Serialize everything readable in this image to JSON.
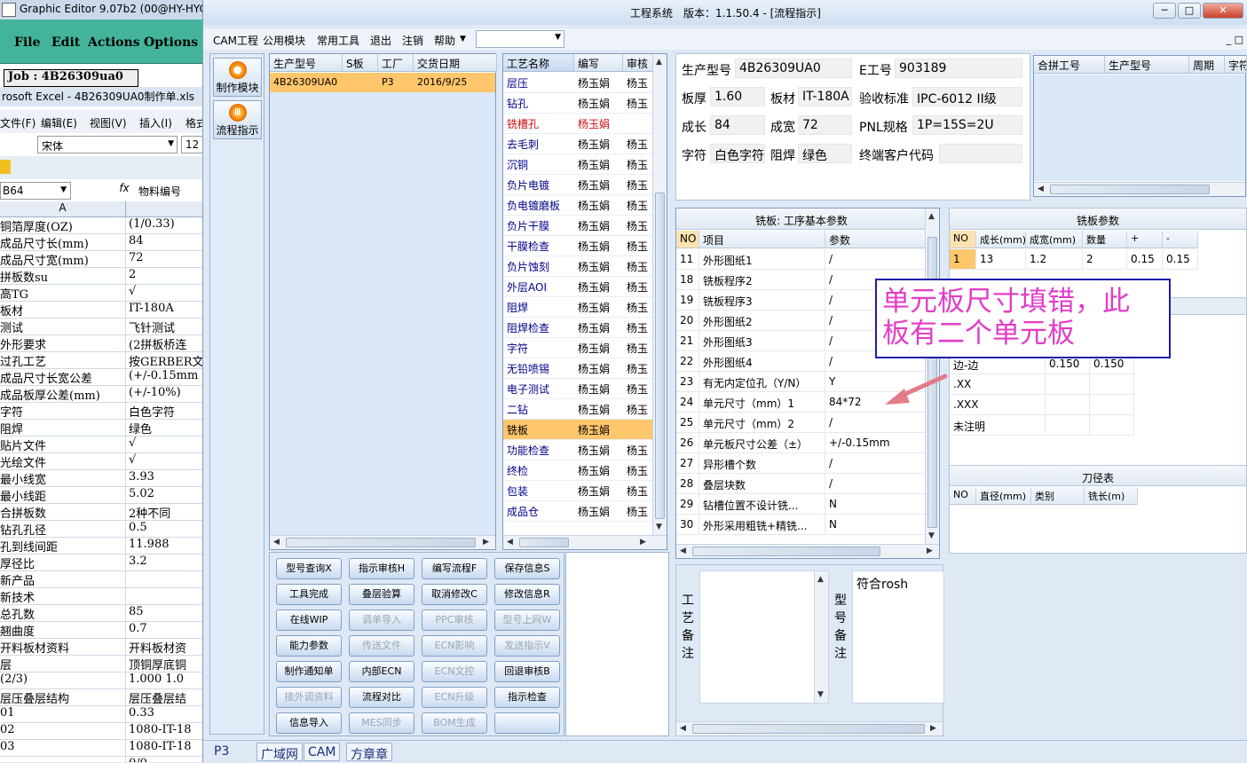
{
  "graphic_editor": {
    "title": "Graphic Editor 9.07b2 (00@HY-HYC",
    "menu": [
      "File",
      "Edit",
      "Actions",
      "Options"
    ],
    "job": "Job : 4B26309ua0"
  },
  "excel": {
    "title": "rosoft Excel - 4B26309UA0制作单.xls",
    "menu": [
      "文件(F)",
      "编辑(E)",
      "视图(V)",
      "插入(I)",
      "格式"
    ],
    "font_name": "宋体",
    "font_size": "12",
    "name_box": "B64",
    "fx": "fx",
    "formula": "物料编号",
    "col_header": "A",
    "rows": [
      [
        "铜箔厚度(OZ)",
        "(1/0.33)"
      ],
      [
        "成品尺寸长(mm)",
        "84"
      ],
      [
        "成品尺寸宽(mm)",
        "72"
      ],
      [
        "拼板数su",
        "2"
      ],
      [
        "高TG",
        "√"
      ],
      [
        "板材",
        "IT-180A"
      ],
      [
        "测试",
        "飞针测试"
      ],
      [
        "外形要求",
        "(2拼板桥连"
      ],
      [
        "过孔工艺",
        "按GERBER文"
      ],
      [
        "成品尺寸长宽公差",
        "(+/-0.15mm"
      ],
      [
        "成品板厚公差(mm)",
        "(+/-10%)"
      ],
      [
        "字符",
        "白色字符"
      ],
      [
        "阻焊",
        "绿色"
      ],
      [
        "贴片文件",
        "√"
      ],
      [
        "光绘文件",
        "√"
      ],
      [
        "最小线宽",
        "3.93"
      ],
      [
        "最小线距",
        "5.02"
      ],
      [
        "合拼板数",
        "2种不同"
      ],
      [
        "钻孔孔径",
        "0.5"
      ],
      [
        "孔到线间距",
        "11.988"
      ],
      [
        "厚径比",
        "3.2"
      ],
      [
        "新产品",
        ""
      ],
      [
        "新技术",
        ""
      ],
      [
        "总孔数",
        "85"
      ],
      [
        "翘曲度",
        "0.7"
      ],
      [
        "开料板材资料",
        "开料板材资"
      ],
      [
        "层",
        "顶铜厚底铜"
      ],
      [
        "(2/3)",
        "1.000  1.0"
      ],
      [
        "层压叠层结构",
        "层压叠层结"
      ],
      [
        "01",
        "0.33"
      ],
      [
        "02",
        "1080-IT-18"
      ],
      [
        "03",
        "1080-IT-18"
      ],
      [
        "",
        "0/0"
      ]
    ]
  },
  "cam": {
    "title": "工程系统　版本：1.1.50.4 - [流程指示]",
    "win_buttons": [
      "─",
      "□",
      "✕"
    ],
    "menu": [
      "CAM工程",
      "公用模块",
      "常用工具",
      "退出",
      "注销",
      "帮助"
    ],
    "mdi_buttons": "_ □",
    "nav": [
      {
        "label": "制作模块",
        "icon": "fire-icon"
      },
      {
        "label": "流程指示",
        "icon": "flow-icon"
      }
    ],
    "product_grid": {
      "headers": [
        "生产型号",
        "S板",
        "工厂",
        "交货日期"
      ],
      "rows": [
        [
          "4B26309UA0",
          "",
          "P3",
          "2016/9/25"
        ]
      ]
    },
    "process_grid": {
      "headers": [
        "工艺名称",
        "编写",
        "审核"
      ],
      "rows": [
        [
          "层压",
          "杨玉娟",
          "杨玉"
        ],
        [
          "钻孔",
          "杨玉娟",
          "杨玉"
        ],
        [
          "铣槽孔",
          "杨玉娟",
          ""
        ],
        [
          "去毛刺",
          "杨玉娟",
          "杨玉"
        ],
        [
          "沉铜",
          "杨玉娟",
          "杨玉"
        ],
        [
          "负片电镀",
          "杨玉娟",
          "杨玉"
        ],
        [
          "负电镀磨板",
          "杨玉娟",
          "杨玉"
        ],
        [
          "负片干膜",
          "杨玉娟",
          "杨玉"
        ],
        [
          "干膜检查",
          "杨玉娟",
          "杨玉"
        ],
        [
          "负片蚀刻",
          "杨玉娟",
          "杨玉"
        ],
        [
          "外层AOI",
          "杨玉娟",
          "杨玉"
        ],
        [
          "阻焊",
          "杨玉娟",
          "杨玉"
        ],
        [
          "阻焊检查",
          "杨玉娟",
          "杨玉"
        ],
        [
          "字符",
          "杨玉娟",
          "杨玉"
        ],
        [
          "无铅喷锡",
          "杨玉娟",
          "杨玉"
        ],
        [
          "电子测试",
          "杨玉娟",
          "杨玉"
        ],
        [
          "二钻",
          "杨玉娟",
          "杨玉"
        ],
        [
          "铣板",
          "杨玉娟",
          ""
        ],
        [
          "功能检查",
          "杨玉娟",
          "杨玉"
        ],
        [
          "终检",
          "杨玉娟",
          "杨玉"
        ],
        [
          "包装",
          "杨玉娟",
          "杨玉"
        ],
        [
          "成品仓",
          "杨玉娟",
          "杨玉"
        ]
      ]
    },
    "buttons": [
      [
        "型号查询X",
        "指示审核H",
        "编写流程F",
        "保存信息S"
      ],
      [
        "工具完成",
        "叠层验算",
        "取消修改C",
        "修改信息R"
      ],
      [
        "在线WIP",
        "调单导入",
        "PPC审核",
        "型号上网W"
      ],
      [
        "能力参数",
        "传送文件",
        "ECN影响",
        "发送指示V"
      ],
      [
        "制作通知单",
        "内部ECN",
        "ECN文控",
        "回退审核B"
      ],
      [
        "接外调资料",
        "流程对比",
        "ECN升级",
        "指示检查"
      ],
      [
        "信息导入",
        "MES同步",
        "BOM生成",
        ""
      ]
    ],
    "info": {
      "prod_model_label": "生产型号",
      "prod_model": "4B26309UA0",
      "e_no_label": "E工号",
      "e_no": "903189",
      "thickness_label": "板厚",
      "thickness": "1.60",
      "material_label": "板材",
      "material": "IT-180A",
      "standard_label": "验收标准",
      "standard": "IPC-6012 II级",
      "length_label": "成长",
      "length": "84",
      "width_label": "成宽",
      "width": "72",
      "pnl_label": "PNL规格",
      "pnl": "1P=15S=2U",
      "char_label": "字符",
      "char": "白色字符",
      "mask_label": "阻焊",
      "mask": "绿色",
      "customer_label": "终端客户代码",
      "customer": ""
    },
    "merge_grid": {
      "headers": [
        "合拼工号",
        "生产型号",
        "周期",
        "字符"
      ]
    },
    "param_table": {
      "title": "铣板: 工序基本参数",
      "headers": [
        "NO",
        "项目",
        "参数"
      ],
      "rows": [
        [
          "11",
          "外形图纸1",
          "/"
        ],
        [
          "18",
          "铣板程序2",
          "/"
        ],
        [
          "19",
          "铣板程序3",
          "/"
        ],
        [
          "20",
          "外形图纸2",
          "/"
        ],
        [
          "21",
          "外形图纸3",
          "/"
        ],
        [
          "22",
          "外形图纸4",
          "/"
        ],
        [
          "23",
          "有无内定位孔（Y/N）",
          "Y"
        ],
        [
          "24",
          "单元尺寸（mm）1",
          "84*72"
        ],
        [
          "25",
          "单元尺寸（mm）2",
          "/"
        ],
        [
          "26",
          "单元板尺寸公差（±）",
          "+/-0.15mm"
        ],
        [
          "27",
          "异形槽个数",
          "/"
        ],
        [
          "28",
          "叠层块数",
          "/"
        ],
        [
          "29",
          "钻槽位置不设计铣...",
          "N"
        ],
        [
          "30",
          "外形采用粗铣+精铣...",
          "N"
        ]
      ]
    },
    "mill_params": {
      "title": "铣板参数",
      "headers": [
        "NO",
        "成长(mm)",
        "成宽(mm)",
        "数量",
        "+",
        "-"
      ],
      "rows": [
        [
          "1",
          "13",
          "1.2",
          "2",
          "0.15",
          "0.15"
        ]
      ]
    },
    "tolerance": {
      "rows": [
        [
          "边-边",
          "0.150",
          "0.150"
        ],
        [
          ".XX",
          "",
          ""
        ],
        [
          ".XXX",
          "",
          ""
        ],
        [
          "未注明",
          "",
          ""
        ]
      ]
    },
    "tool_table": {
      "title": "刀径表",
      "headers": [
        "NO",
        "直径(mm)",
        "类别",
        "铣长(m)"
      ]
    },
    "process_note_label": "工艺备注",
    "model_note_label": "型号备注",
    "model_note": "符合rosh",
    "annotation": [
      "单元板尺寸填错，此",
      "板有二个单元板"
    ],
    "status_tabs": [
      "P3",
      "广域网",
      "CAM",
      "方章章"
    ]
  }
}
